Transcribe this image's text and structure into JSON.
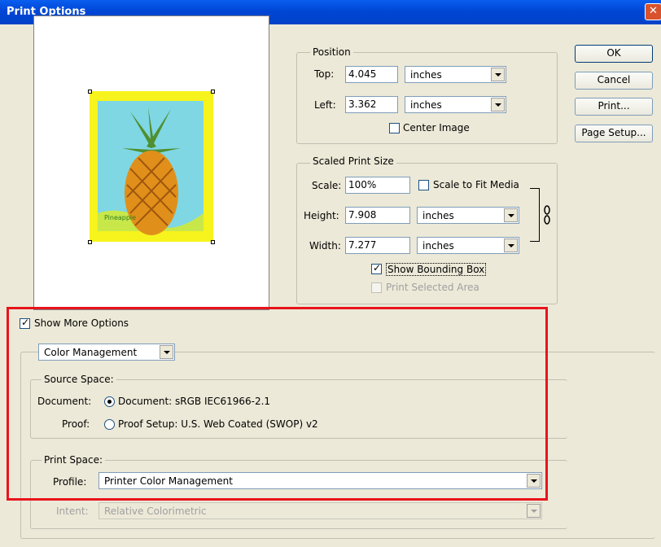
{
  "window": {
    "title": "Print Options",
    "close_glyph": "✕"
  },
  "buttons": {
    "ok": "OK",
    "cancel": "Cancel",
    "print": "Print...",
    "page_setup": "Page Setup..."
  },
  "position": {
    "group_label": "Position",
    "top_label": "Top:",
    "top_value": "4.045",
    "top_unit": "inches",
    "left_label": "Left:",
    "left_value": "3.362",
    "left_unit": "inches",
    "center_image_label": "Center Image",
    "center_image_checked": false
  },
  "scaled": {
    "group_label": "Scaled Print Size",
    "scale_label": "Scale:",
    "scale_value": "100%",
    "scale_to_fit_label": "Scale to Fit Media",
    "scale_to_fit_checked": false,
    "height_label": "Height:",
    "height_value": "7.908",
    "height_unit": "inches",
    "width_label": "Width:",
    "width_value": "7.277",
    "width_unit": "inches",
    "show_bounding_box_label": "Show Bounding Box",
    "show_bounding_box_checked": true,
    "print_selected_area_label": "Print Selected Area",
    "print_selected_area_checked": false
  },
  "more_options": {
    "label": "Show More Options",
    "checked": true
  },
  "color_mgmt": {
    "dropdown_value": "Color Management",
    "source_space_label": "Source Space:",
    "document_row_label": "Document:",
    "document_radio_label": "Document:  sRGB IEC61966-2.1",
    "proof_row_label": "Proof:",
    "proof_radio_label": "Proof Setup:  U.S. Web Coated (SWOP) v2",
    "print_space_label": "Print Space:",
    "profile_label": "Profile:",
    "profile_value": "Printer Color Management",
    "intent_label": "Intent:",
    "intent_value": "Relative Colorimetric"
  },
  "preview": {
    "image_caption": "Pineapple"
  },
  "colors": {
    "accent_highlight": "#e8141c",
    "titlebar": "#0046d5"
  }
}
